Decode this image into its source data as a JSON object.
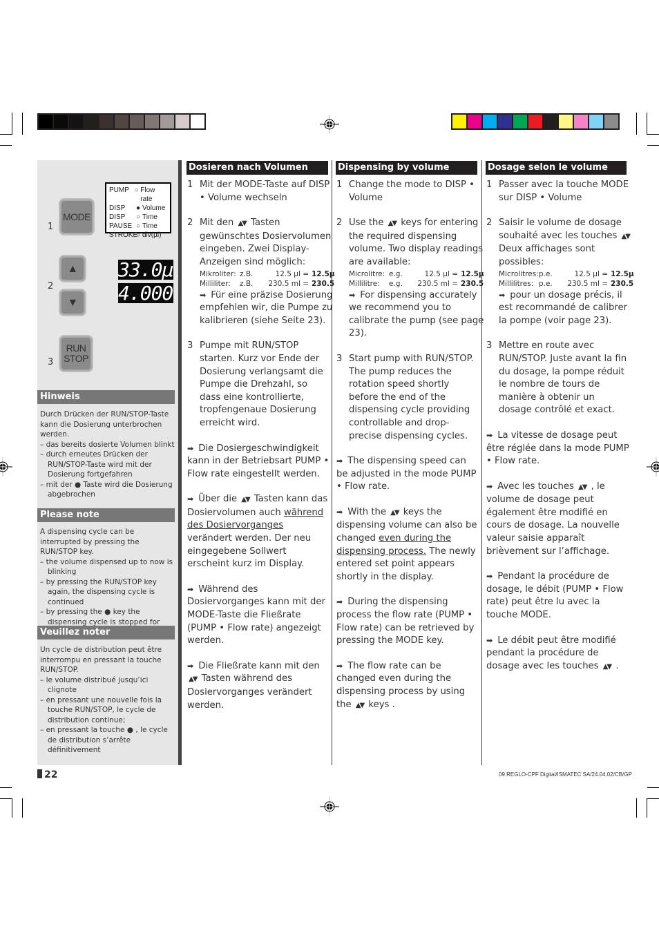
{
  "print_marks": {
    "gray_bar": [
      "#000000",
      "#0c0a09",
      "#141212",
      "#221f1d",
      "#3a3230",
      "#504644",
      "#675c5b",
      "#817777",
      "#a39b9a",
      "#d4cccc",
      "#ffffff"
    ],
    "color_bar": [
      "#fff200",
      "#ec008c",
      "#00aeef",
      "#2e3192",
      "#00a651",
      "#ed1c24",
      "#231f20",
      "#fff685",
      "#f682c8",
      "#7fd3f7",
      "#8c8c8c"
    ]
  },
  "left_panel": {
    "steps": [
      {
        "number": "1",
        "button": "MODE"
      },
      {
        "number": "2",
        "button_up": "▲",
        "button_down": "▼"
      },
      {
        "number": "3",
        "button": "RUN STOP"
      }
    ],
    "mode_table": [
      {
        "mode": "PUMP",
        "selected": false,
        "param": "Flow rate"
      },
      {
        "mode": "DISP",
        "selected": true,
        "param": "Volume"
      },
      {
        "mode": "DISP",
        "selected": false,
        "param": "Time"
      },
      {
        "mode": "PAUSE",
        "selected": false,
        "param": "Time"
      },
      {
        "mode": "STROKE",
        "selected": false,
        "param": "div(µl)"
      }
    ],
    "display_line1": "33.0µ",
    "display_line2": "4.000",
    "notes": [
      {
        "title": "Hinweis",
        "intro": "Durch Drücken der RUN/STOP-Taste kann die Dosierung unterbrochen werden.",
        "items": [
          "das bereits dosierte Volumen blinkt",
          "durch erneutes Drücken der RUN/STOP-Taste wird mit der Dosierung fortgefahren",
          "mit der ● Taste wird die Dosierung abgebrochen"
        ]
      },
      {
        "title": "Please note",
        "intro": "A dispensing cycle can be interrupted by pressing the RUN/STOP key.",
        "items": [
          "the volume dispensed up to now is blinking",
          "by pressing the RUN/STOP key again, the dispensing cycle is continued",
          "by pressing the ● key the dispensing cycle is stopped for good"
        ]
      },
      {
        "title": "Veuillez noter",
        "intro": "Un cycle de distribution peut être interrompu en pressant la touche RUN/STOP.",
        "items": [
          "le volume distribué jusqu’ici clignote",
          "en pressant une nouvelle fois la touche RUN/STOP, le cycle de distribution continue;",
          "en pressant la touche ● , le cycle de distribution s’arrête définitivement"
        ]
      }
    ]
  },
  "columns": [
    {
      "title": "Dosieren nach Volumen",
      "step1": {
        "n": "1",
        "text": "Mit der MODE-Taste auf DISP • Volume wechseln"
      },
      "step2": {
        "n": "2",
        "pre": "Mit den",
        "post": "Tasten gewünschtes Dosiervolumen eingeben. Zwei Display-Anzeigen sind möglich:"
      },
      "ex1": {
        "label": "Mikroliter:",
        "eg": "z.B.",
        "val": "12.5 µl =",
        "disp": "12.5µ"
      },
      "ex2": {
        "label": "Milliliter:",
        "eg": "z.B.",
        "val": "230.5 ml =",
        "disp": "230.5"
      },
      "calib": "Für eine präzise Dosierung empfehlen wir, die Pumpe zu kalibrieren (siehe Seite 23).",
      "step3": {
        "n": "3",
        "text": "Pumpe mit RUN/STOP starten. Kurz vor Ende der Dosierung verlangsamt die Pumpe die Drehzahl, so dass eine kontrollierte, tropfengenaue Dosierung erreicht wird."
      },
      "tip1": "Die Dosiergeschwindigkeit kann in der Betriebsart PUMP • Flow rate eingestellt werden.",
      "tip2_pre": "Über die",
      "tip2_mid": "Tasten kann das Dosiervolumen auch",
      "tip2_u": "während des Dosiervorganges",
      "tip2_post": "verändert werden. Der neu eingegebene Sollwert erscheint kurz im Display.",
      "tip3": "Während des Dosiervorganges kann mit der MODE-Taste die Fließrate (PUMP • Flow rate) angezeigt werden.",
      "tip4_pre": "Die Fließrate kann mit den",
      "tip4_post": "Tasten während des Dosiervorganges verändert werden."
    },
    {
      "title": "Dispensing by volume",
      "step1": {
        "n": "1",
        "text": "Change the mode to DISP • Volume"
      },
      "step2": {
        "n": "2",
        "pre": "Use the",
        "post": "keys for entering the required dispensing volume. Two display readings are available:"
      },
      "ex1": {
        "label": "Microlitre:",
        "eg": "e.g.",
        "val": "12.5 µl =",
        "disp": "12.5µ"
      },
      "ex2": {
        "label": "Millilitre:",
        "eg": "e.g.",
        "val": "230.5 ml =",
        "disp": "230.5"
      },
      "calib": "For dispensing accurately we recommend you to calibrate the pump (see page 23).",
      "step3": {
        "n": "3",
        "text": "Start pump with RUN/STOP. The pump reduces the rotation speed shortly before the end of the dispensing cycle providing controllable and drop-precise dispensing cycles."
      },
      "tip1": "The dispensing speed can be adjusted in the mode PUMP • Flow rate.",
      "tip2_pre": "With the",
      "tip2_mid": "keys the dispensing volume can also be changed",
      "tip2_u": "even during the dispensing process.",
      "tip2_post": "The newly entered set point appears shortly in the display.",
      "tip3": "During the dispensing process the flow rate (PUMP • Flow rate) can be retrieved by pressing the MODE key.",
      "tip4_pre": "The flow rate can be changed even during the dispensing process by using the",
      "tip4_post": "keys ."
    },
    {
      "title": "Dosage selon le volume",
      "step1": {
        "n": "1",
        "text": "Passer avec la touche MODE sur DISP • Volume"
      },
      "step2": {
        "n": "2",
        "pre": "Saisir le volume de dosage souhaité avec les touches",
        "post": "Deux affichages sont possibles:"
      },
      "ex1": {
        "label": "Microlitres:",
        "eg": "p.e.",
        "val": "12.5 µl =",
        "disp": "12.5µ"
      },
      "ex2": {
        "label": "Millilitres:",
        "eg": "p.e.",
        "val": "230.5 ml =",
        "disp": "230.5"
      },
      "calib": "pour un dosage précis, il est recommandé de calibrer la pompe (voir page 23).",
      "step3": {
        "n": "3",
        "text": "Mettre en route avec RUN/STOP. Juste avant la fin du dosage, la pompe réduit le nombre de tours de manière à obtenir un dosage contrôlé et exact."
      },
      "tip1": "La vitesse de dosage peut être réglée dans la mode PUMP • Flow rate.",
      "tip2_pre": "Avec les touches",
      "tip2_mid": ", le volume de dosage peut également être modifié en cours de dosage. La nouvelle valeur saisie apparaît brièvement sur l’affichage.",
      "tip2_u": "",
      "tip2_post": "",
      "tip3": "Pendant la procédure de dosage, le débit (PUMP • Flow rate) peut être lu avec la touche MODE.",
      "tip4_pre": "Le débit peut être modifié pendant la procédure de dosage avec les touches",
      "tip4_post": "."
    }
  ],
  "symbols": {
    "arrow": "➡",
    "updown_keys": "▲▼",
    "bullet_key": "●"
  },
  "page_number": "22",
  "footer": "09 REGLO-CPF Digital/ISMATEC SA/24.04.02/CB/GP"
}
